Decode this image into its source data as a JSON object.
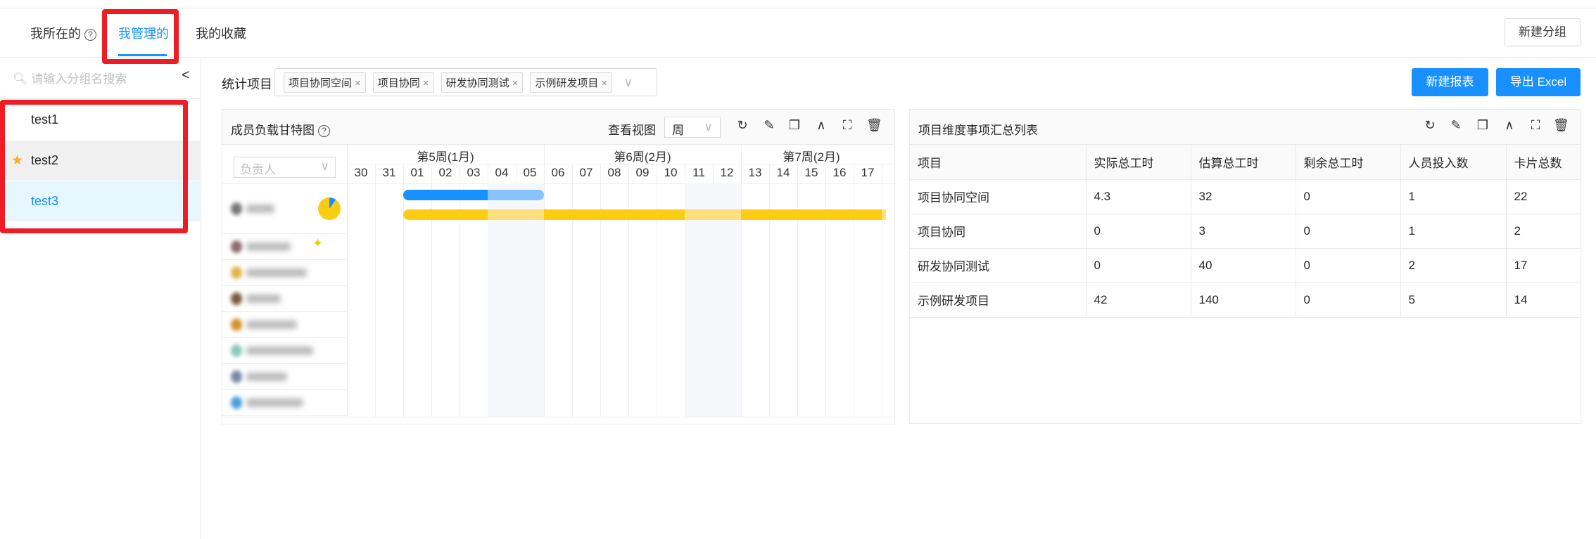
{
  "tabs": [
    {
      "label": "我所在的",
      "help": "?"
    },
    {
      "label": "我管理的"
    },
    {
      "label": "我的收藏"
    }
  ],
  "new_group_label": "新建分组",
  "sidebar": {
    "search_placeholder": "请输入分组名搜索",
    "collapse": "<",
    "items": [
      {
        "label": "test1"
      },
      {
        "label": "test2",
        "starred": true
      },
      {
        "label": "test3",
        "selected": true
      }
    ]
  },
  "filter": {
    "label": "统计项目",
    "tags": [
      "项目协同空间",
      "项目协同",
      "研发协同测试",
      "示例研发项目"
    ]
  },
  "buttons": {
    "new_report": "新建报表",
    "export": "导出 Excel"
  },
  "colors": {
    "accent": "#1890ff",
    "bar_blue": "#1890ff",
    "bar_yellow": "#facc14",
    "highlight": "#ee1c25"
  },
  "gantt": {
    "title": "成员负载甘特图",
    "view_label": "查看视图",
    "view_value": "周",
    "assignee_placeholder": "负责人",
    "icons": [
      "refresh-icon",
      "edit-icon",
      "copy-icon",
      "collapse-icon",
      "fullscreen-icon",
      "delete-icon"
    ],
    "weeks": [
      {
        "label": "第5周(1月)",
        "span": 7,
        "start": 0
      },
      {
        "label": "第6周(2月)",
        "span": 7,
        "start": 7
      },
      {
        "label": "第7周(2月)",
        "span": 5,
        "start": 14
      }
    ],
    "days": [
      "30",
      "31",
      "01",
      "02",
      "03",
      "04",
      "05",
      "06",
      "07",
      "08",
      "09",
      "10",
      "11",
      "12",
      "13",
      "14",
      "15",
      "16",
      "17"
    ],
    "weekend_days": [
      "04",
      "05",
      "11",
      "12"
    ],
    "member_count": 8,
    "blue_bar": {
      "start": "01",
      "end": "05",
      "solid_until": "03"
    },
    "yellow_bar": {
      "start": "01",
      "end": "17"
    },
    "pie_fraction_blue": 0.1
  },
  "table": {
    "title": "项目维度事项汇总列表",
    "icons": [
      "refresh-icon",
      "edit-icon",
      "copy-icon",
      "collapse-icon",
      "fullscreen-icon",
      "delete-icon"
    ],
    "columns": [
      "项目",
      "实际总工时",
      "估算总工时",
      "剩余总工时",
      "人员投入数",
      "卡片总数"
    ],
    "rows": [
      [
        "项目协同空间",
        "4.3",
        "32",
        "0",
        "1",
        "22"
      ],
      [
        "项目协同",
        "0",
        "3",
        "0",
        "1",
        "2"
      ],
      [
        "研发协同测试",
        "0",
        "40",
        "0",
        "2",
        "17"
      ],
      [
        "示例研发项目",
        "42",
        "140",
        "0",
        "5",
        "14"
      ]
    ]
  }
}
